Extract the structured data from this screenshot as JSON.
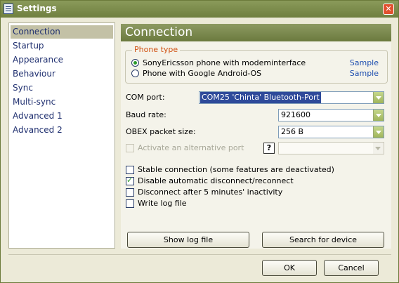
{
  "window": {
    "title": "Settings",
    "close_glyph": "✕"
  },
  "sidebar": {
    "items": [
      {
        "label": "Connection",
        "selected": true
      },
      {
        "label": "Startup"
      },
      {
        "label": "Appearance"
      },
      {
        "label": "Behaviour"
      },
      {
        "label": "Sync"
      },
      {
        "label": "Multi-sync"
      },
      {
        "label": "Advanced 1"
      },
      {
        "label": "Advanced 2"
      }
    ]
  },
  "content": {
    "title": "Connection",
    "phone_type": {
      "legend": "Phone type",
      "options": [
        {
          "label": "SonyEricsson phone with modeminterface",
          "selected": true,
          "link": "Sample"
        },
        {
          "label": "Phone with Google Android-OS",
          "selected": false,
          "link": "Sample"
        }
      ]
    },
    "com_port": {
      "label": "COM port:",
      "value": "COM25  'Chinta' Bluetooth-Port"
    },
    "baud_rate": {
      "label": "Baud rate:",
      "value": "921600"
    },
    "obex": {
      "label": "OBEX packet size:",
      "value": "256 B"
    },
    "alt_port": {
      "label": "Activate an alternative port",
      "help": "?",
      "value": ""
    },
    "checkboxes": [
      {
        "label": "Stable connection (some features are deactivated)",
        "checked": false
      },
      {
        "label": "Disable automatic disconnect/reconnect",
        "checked": true
      },
      {
        "label": "Disconnect after 5 minutes' inactivity",
        "checked": false
      },
      {
        "label": "Write log file",
        "checked": false
      }
    ],
    "show_log_label": "Show log file",
    "search_label": "Search for device"
  },
  "footer": {
    "ok_label": "OK",
    "cancel_label": "Cancel"
  },
  "colors": {
    "accent": "#7a8a4a",
    "link": "#1f4fb0",
    "legend": "#d05010",
    "check": "#2a9a2a"
  }
}
